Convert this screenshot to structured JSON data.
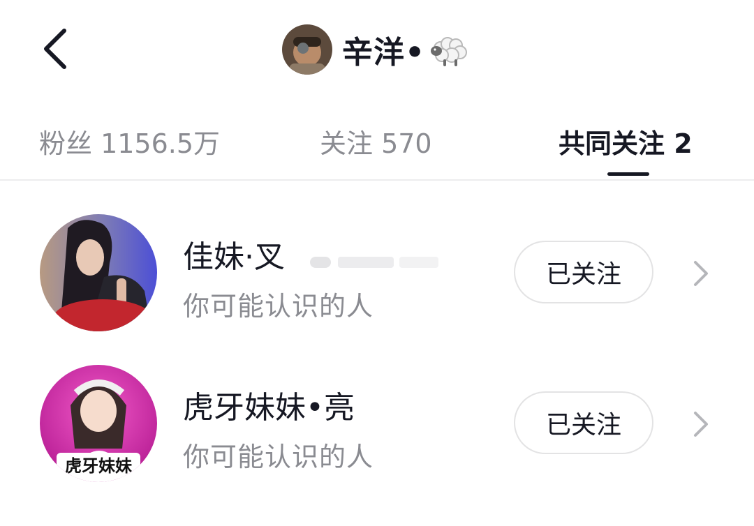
{
  "header": {
    "title": "辛洋•",
    "back_icon": "chevron-left-icon",
    "title_emoji": "sheep-icon"
  },
  "tabs": [
    {
      "label": "粉丝 1156.5万",
      "active": false
    },
    {
      "label": "关注 570",
      "active": false
    },
    {
      "label": "共同关注 2",
      "active": true
    }
  ],
  "list": [
    {
      "name": "佳妹·叉",
      "subtitle": "你可能认识的人",
      "button_label": "已关注",
      "chevron_icon": "chevron-right-icon"
    },
    {
      "name": "虎牙妹妹•亮",
      "subtitle": "你可能认识的人",
      "button_label": "已关注",
      "chevron_icon": "chevron-right-icon",
      "avatar_caption": "虎牙妹妹"
    }
  ],
  "colors": {
    "text_primary": "#161823",
    "text_secondary": "#8a8b91",
    "divider": "#ededee",
    "button_border": "#e3e3e4"
  }
}
